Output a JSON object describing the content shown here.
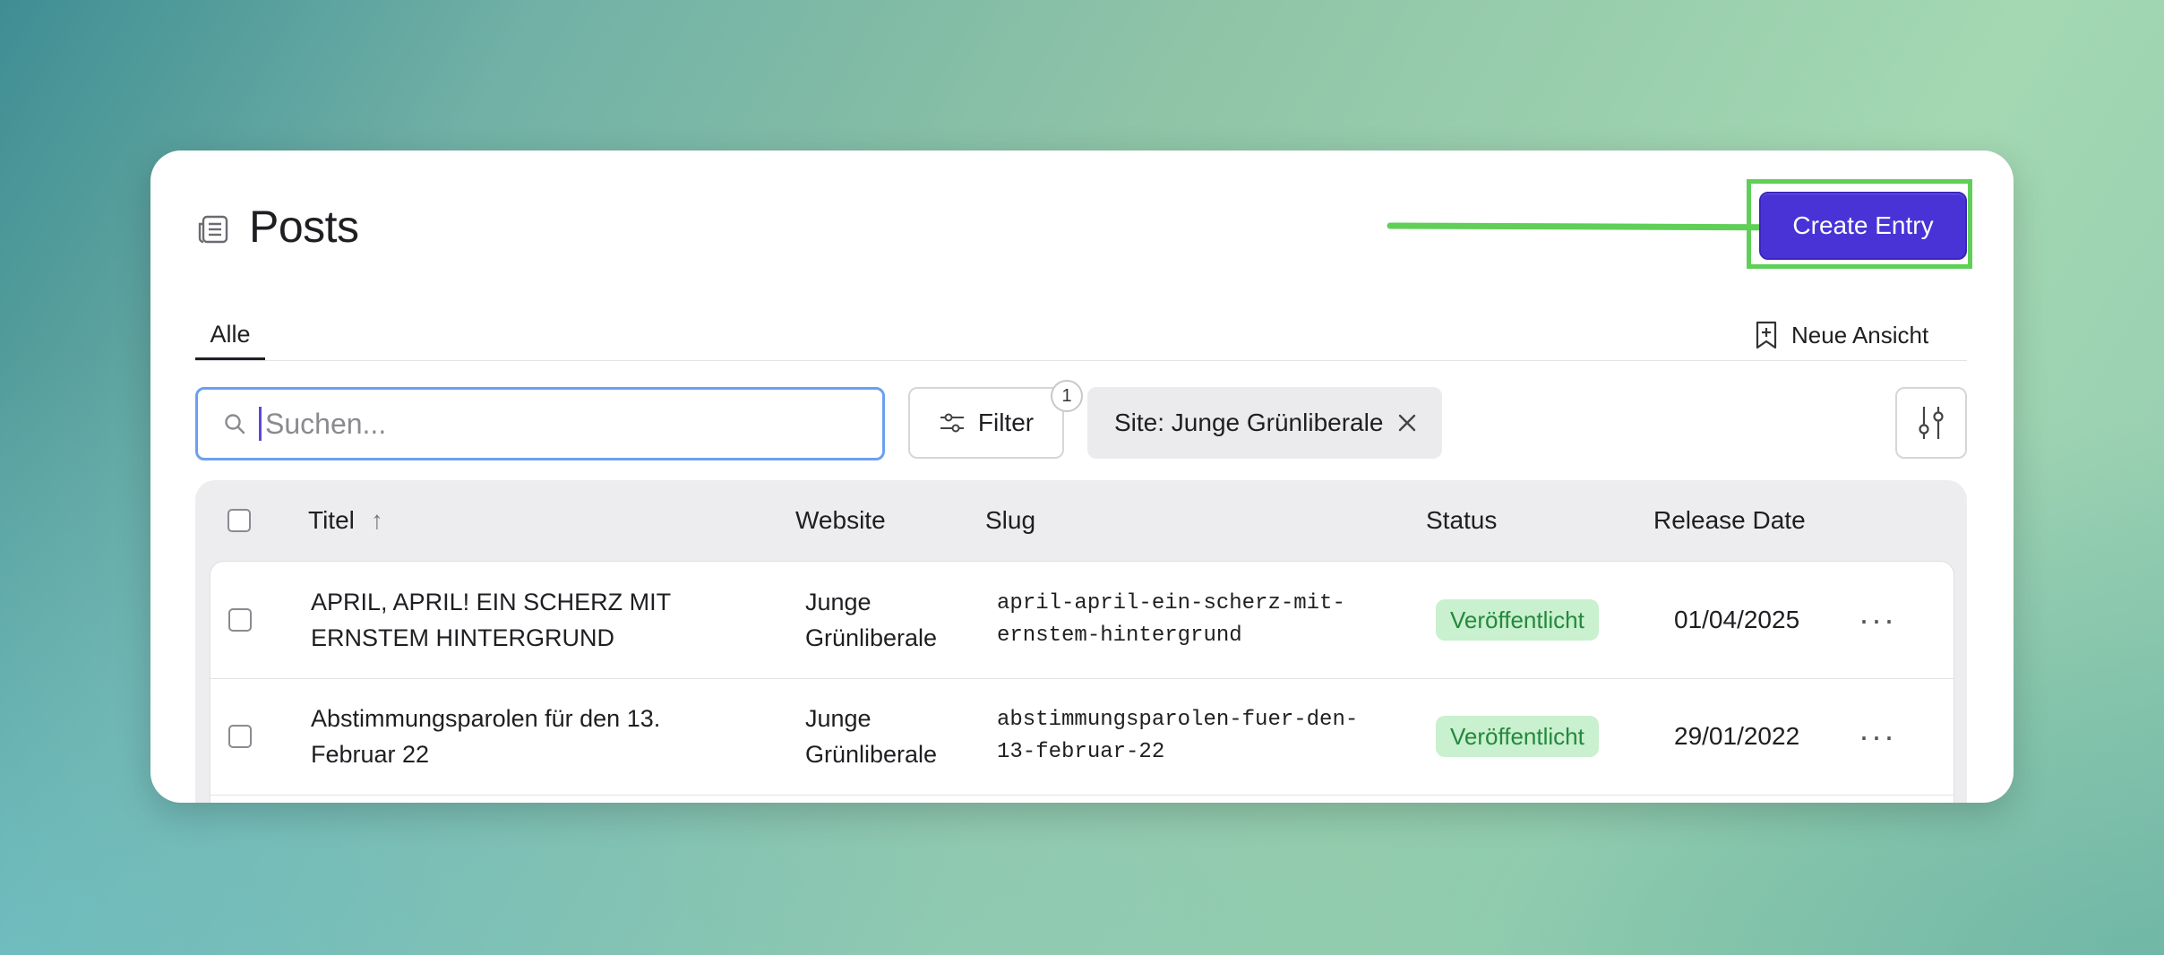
{
  "page": {
    "title": "Posts",
    "create_label": "Create Entry",
    "accent_color": "#4a33d6",
    "highlight_color": "#5fcf57"
  },
  "tabs": [
    {
      "label": "Alle"
    }
  ],
  "new_view_label": "Neue Ansicht",
  "search": {
    "placeholder": "Suchen..."
  },
  "filter": {
    "label": "Filter",
    "count": "1"
  },
  "active_filter": {
    "label": "Site: Junge Grünliberale"
  },
  "table": {
    "columns": {
      "title": "Titel",
      "website": "Website",
      "slug": "Slug",
      "status": "Status",
      "release": "Release Date"
    },
    "sort_indicator": "↑",
    "rows": [
      {
        "title_line1": "APRIL, APRIL! EIN SCHERZ MIT",
        "title_line2": "ERNSTEM HINTERGRUND",
        "website_line1": "Junge",
        "website_line2": "Grünliberale",
        "slug_line1": "april-april-ein-scherz-mit-",
        "slug_line2": "ernstem-hintergrund",
        "status": "Veröffentlicht",
        "release": "01/04/2025",
        "actions": "···"
      },
      {
        "title_line1": "Abstimmungsparolen für den 13.",
        "title_line2": "Februar 22",
        "website_line1": "Junge",
        "website_line2": "Grünliberale",
        "slug_line1": "abstimmungsparolen-fuer-den-",
        "slug_line2": "13-februar-22",
        "status": "Veröffentlicht",
        "release": "29/01/2022",
        "actions": "···"
      }
    ]
  }
}
